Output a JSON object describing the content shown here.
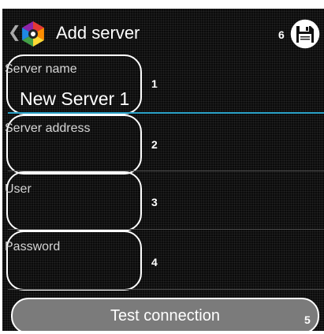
{
  "header": {
    "title": "Add server",
    "save_badge": "6"
  },
  "form": {
    "fields": [
      {
        "label": "Server name",
        "value": "New Server 1",
        "badge": "1"
      },
      {
        "label": "Server address",
        "value": "",
        "badge": "2"
      },
      {
        "label": "User",
        "value": "",
        "badge": "3"
      },
      {
        "label": "Password",
        "value": "",
        "badge": "4"
      }
    ]
  },
  "footer": {
    "test_button_label": "Test connection",
    "test_badge": "5"
  },
  "icons": {
    "back": "chevron-left-icon",
    "logo": "multicolor-hexagon-logo",
    "save": "floppy-disk-icon"
  },
  "colors": {
    "accent": "#2aa1c7",
    "button": "#7b7b7b",
    "background": "#0b0b0b"
  }
}
